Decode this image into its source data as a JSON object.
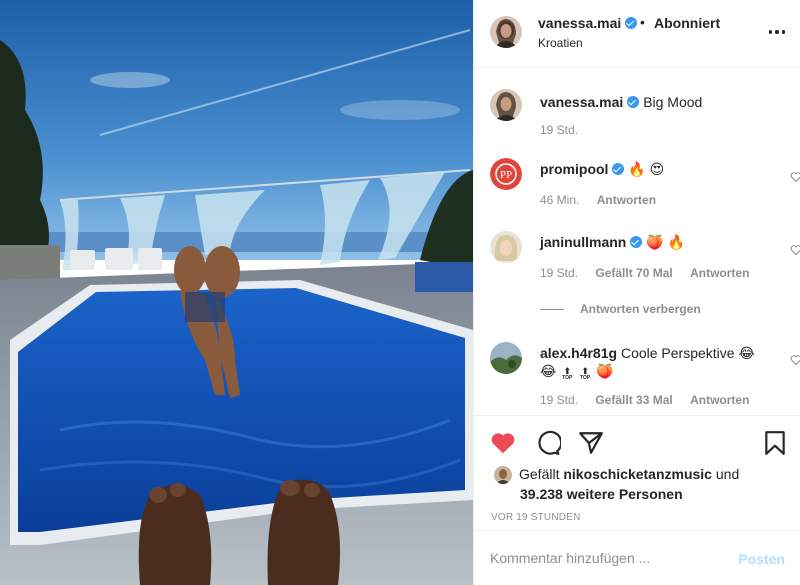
{
  "post": {
    "author": "vanessa.mai",
    "follow_state": "Abonniert",
    "separator": "•",
    "location": "Kroatien"
  },
  "caption": {
    "username": "vanessa.mai",
    "text": "Big Mood",
    "time": "19 Std."
  },
  "comments": [
    {
      "username": "promipool",
      "text": "🔥 😍",
      "time": "46 Min.",
      "likes": "",
      "reply": "Antworten"
    },
    {
      "username": "janinullmann",
      "text": "🍑 🔥",
      "time": "19 Std.",
      "likes": "Gefällt 70 Mal",
      "reply": "Antworten"
    },
    {
      "username": "alex.h4r81g",
      "text": "Coole Perspektive 😂",
      "text2": "😂",
      "top_label": "TOP",
      "text3": "🍑",
      "time": "19 Std.",
      "likes": "Gefällt 33 Mal",
      "reply": "Antworten"
    }
  ],
  "hide_replies": "Antworten verbergen",
  "likes": {
    "prefix": "Gefällt",
    "user": "nikoschicketanzmusic",
    "conj": "und",
    "others": "39.238 weitere Personen"
  },
  "timestamp": "VOR 19 STUNDEN",
  "add_comment": {
    "placeholder": "Kommentar hinzufügen ...",
    "post_label": "Posten"
  },
  "icons": {
    "like": "heart-filled-icon",
    "comment": "comment-bubble-icon",
    "share": "paper-plane-icon",
    "save": "bookmark-icon",
    "more": "more-dots-icon",
    "verified": "verified-badge-icon"
  },
  "colors": {
    "heart": "#ed4956",
    "verified": "#3897f0",
    "post_disabled": "#b2dffc",
    "muted": "#8e8e8e"
  }
}
